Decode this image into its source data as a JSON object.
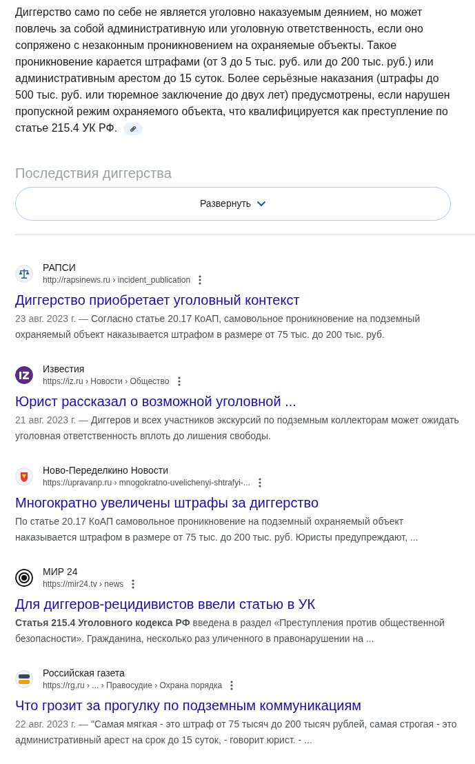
{
  "overview": {
    "text": "Диггерство само по себе не является уголовно наказуемым деянием, но может повлечь за собой административную или уголовную ответственность, если оно сопряжено с незаконным проникновением на охраняемые объекты. Такое проникновение карается штрафами (от 3 до 5 тыс. руб. или до 200 тыс. руб.) или административным арестом до 15 суток. Более серьёзные наказания (штрафы до 500 тыс. руб. или тюремное заключение до двух лет) предусмотрены, если нарушен пропускной режим охраняемого объекта, что квалифицируется как преступление по статье 215.4 УК РФ.",
    "faded_heading": "Последствия диггерства",
    "expand_button": "Развернуть"
  },
  "results": [
    {
      "site": "РАПСИ",
      "url": "http://rapsinews.ru › incident_publication",
      "title": "Диггерство приобретает уголовный контекст",
      "date": "23 авг. 2023 г. —",
      "snippet": "Согласно статье 20.17 КоАП, самовольное проникновение на подземный охраняемый объект наказывается штрафом в размере от 75 тыс. до 200 тыс. руб."
    },
    {
      "site": "Известия",
      "url": "https://iz.ru › Новости › Общество",
      "title": "Юрист рассказал о возможной уголовной ...",
      "date": "21 авг. 2023 г. —",
      "snippet": "Диггеров и всех участников экскурсий по подземным коллекторам может ожидать уголовная ответственность вплоть до лишения свободы."
    },
    {
      "site": "Ново-Переделкино Новости",
      "url": "https://upravanp.ru › mnogokratno-uvelichenyi-shtrafyi-...",
      "title": "Многократно увеличены штрафы за диггерство",
      "snippet": "По статье 20.17 КоАП самовольное проникновение на подземный охраняемый объект наказывается штрафом в размере от 75 тыс. до 200 тыс. руб. Юристы предупреждают, ..."
    },
    {
      "site": "МИР 24",
      "url": "https://mir24.tv › news",
      "title": "Для диггеров-рецидивистов ввели статью в УК",
      "snippet": "**Статья 215.4 Уголовного кодекса РФ** введена в раздел «Преступления против общественной безопасности». Гражданина, несколько раз уличенного в правонарушении на ..."
    },
    {
      "site": "Российская газета",
      "url": "https://rg.ru › ... › Правосудие › Охрана порядка",
      "title": "Что грозит за прогулку по подземным коммуникациям",
      "date": "22 авг. 2023 г. —",
      "snippet": "\"Самая мягкая - это штраф от 75 тысяч до 200 тысяч рублей, самая строгая - это административный арест на срок до 15 суток, - говорит юрист. - ..."
    }
  ]
}
